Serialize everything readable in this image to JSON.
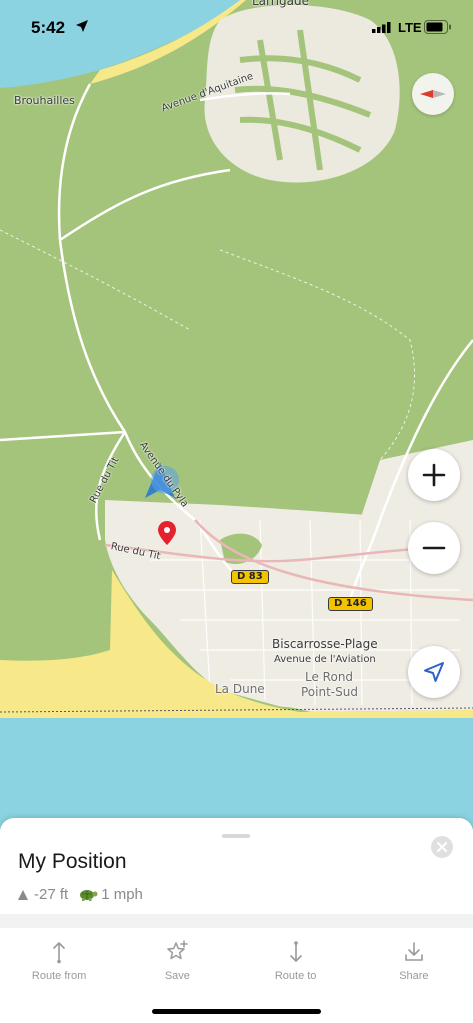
{
  "status_bar": {
    "time": "5:42",
    "network": "LTE"
  },
  "map": {
    "labels": {
      "larrigade": "Larrigade",
      "brouhailles": "Brouhailles",
      "avenue_aquitaine": "Avenue d'Aquitaine",
      "avenue_pyla": "Avenue du Pyla",
      "rue_du_tit_1": "Rue du Tit",
      "rue_du_tit_2": "Rue du Tit",
      "d83": "D 83",
      "d146": "D 146",
      "biscarrosse": "Biscarrosse-Plage",
      "avenue_aviation": "Avenue de l'Aviation",
      "le_rond": "Le Rond",
      "point_sud": "Point-Sud",
      "la_dune": "La Dune"
    },
    "colors": {
      "forest": "#a3c47a",
      "sea": "#8bd3e0",
      "sand": "#f7e88a",
      "urban": "#efece4"
    }
  },
  "sheet": {
    "title": "My Position",
    "elevation": "-27 ft",
    "speed": "1 mph"
  },
  "actions": [
    {
      "label": "Route from",
      "icon": "route-from-icon"
    },
    {
      "label": "Save",
      "icon": "star-plus-icon"
    },
    {
      "label": "Route to",
      "icon": "route-to-icon"
    },
    {
      "label": "Share",
      "icon": "share-icon"
    }
  ]
}
